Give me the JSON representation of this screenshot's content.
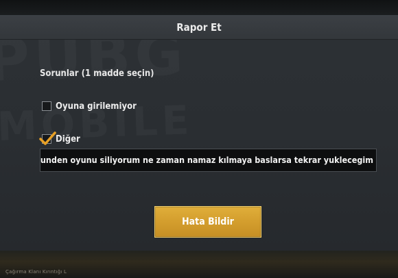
{
  "dialog": {
    "title": "Rapor Et",
    "section_label": "Sorunlar (1 madde seçin)",
    "options": [
      {
        "label": "Oyuna girilemiyor",
        "checked": false
      },
      {
        "label": "Diğer",
        "checked": true
      }
    ],
    "details_value": "ıa yuzunden oyunu siliyorum ne zaman namaz kılmaya baslarsa tekrar yuklecegim",
    "submit_label": "Hata Bildir"
  },
  "background": {
    "bottom_text": "Çağırma Klanı Kırıntığı L"
  },
  "colors": {
    "accent": "#d8a532",
    "checkmark": "#e8a126",
    "dialog_bg": "#2b2f33"
  }
}
